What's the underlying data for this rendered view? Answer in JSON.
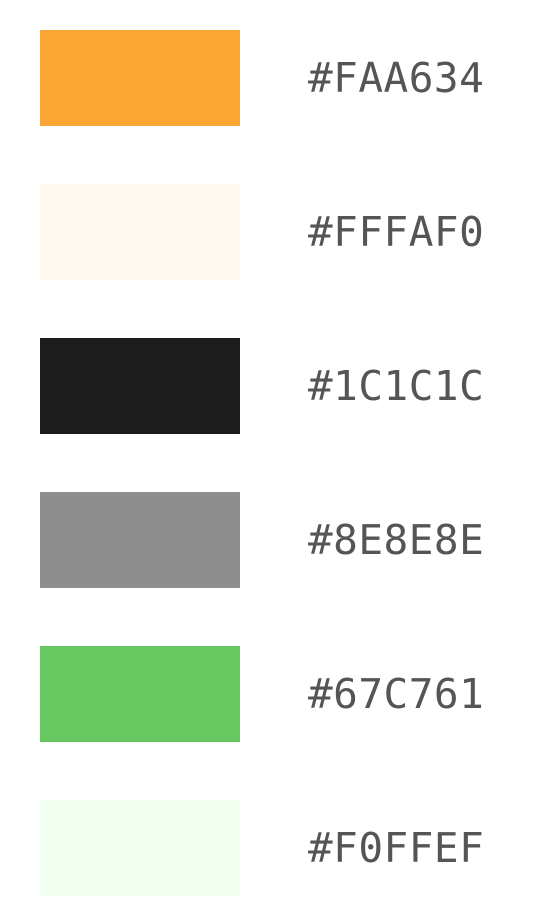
{
  "swatches": [
    {
      "label": "#FAA634",
      "color": "#FAA634"
    },
    {
      "label": "#FFFAF0",
      "color": "#FFFAF0"
    },
    {
      "label": "#1C1C1C",
      "color": "#1C1C1C"
    },
    {
      "label": "#8E8E8E",
      "color": "#8E8E8E"
    },
    {
      "label": "#67C761",
      "color": "#67C761"
    },
    {
      "label": "#F0FFEF",
      "color": "#F0FFEF"
    }
  ]
}
